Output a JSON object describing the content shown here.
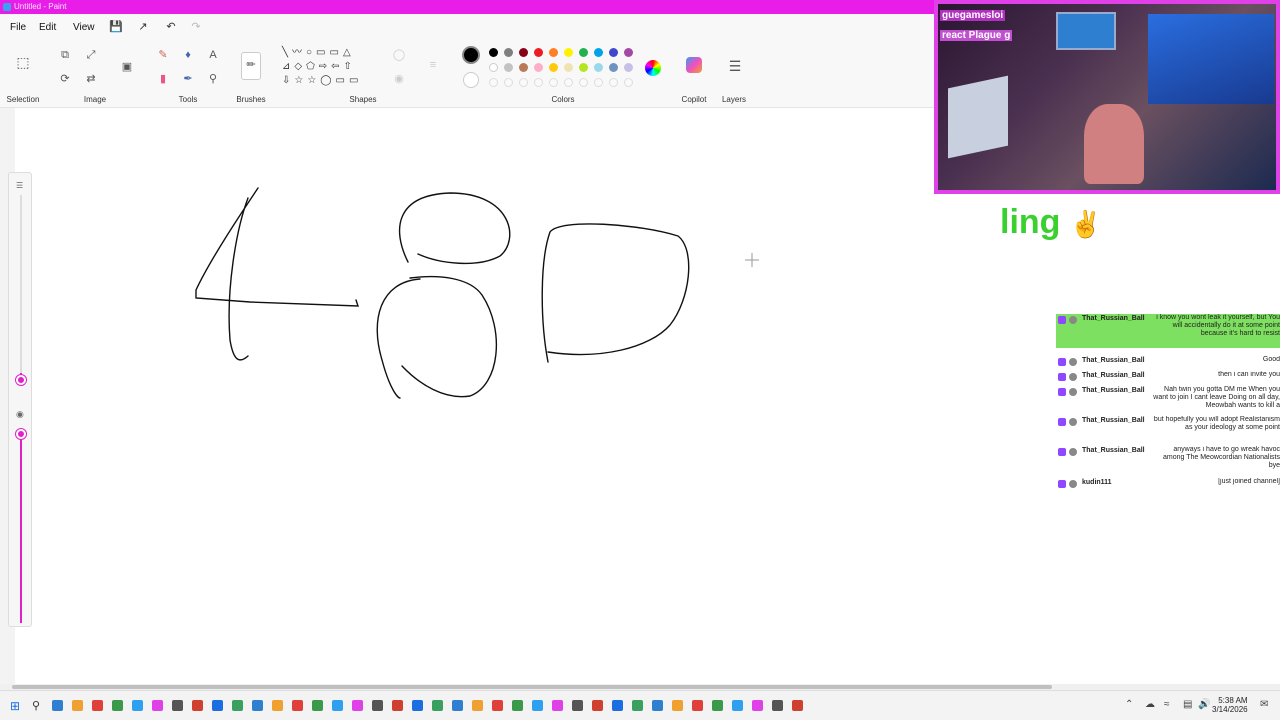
{
  "window": {
    "title": "Untitled - Paint"
  },
  "menu": {
    "file": "File",
    "edit": "Edit",
    "view": "View"
  },
  "ribbon": {
    "groups": {
      "selection": "Selection",
      "image": "Image",
      "tools": "Tools",
      "brushes": "Brushes",
      "shapes": "Shapes",
      "colors": "Colors",
      "copilot": "Copilot",
      "layers": "Layers"
    },
    "palette_row1": [
      "#000000",
      "#7f7f7f",
      "#880015",
      "#ed1c24",
      "#ff7f27",
      "#fff200",
      "#22b14c",
      "#00a2e8",
      "#3f48cc",
      "#a349a4"
    ],
    "palette_row2": [
      "#ffffff",
      "#c3c3c3",
      "#b97a57",
      "#ffaec9",
      "#ffc90e",
      "#efe4b0",
      "#b5e61d",
      "#99d9ea",
      "#7092be",
      "#c8bfe7"
    ],
    "primary_color": "#000000",
    "secondary_color": "#ffffff"
  },
  "stream": {
    "overlay_text": "ling",
    "camera_title": "guegamesloi",
    "camera_subtitle": "react Plague g",
    "chat": [
      {
        "user": "That_Russian_Ball",
        "message": "i know you wont leak it yourself, but You will accidentally do it at some point because it's hard to resist"
      },
      {
        "user": "That_Russian_Ball",
        "message": "Good"
      },
      {
        "user": "That_Russian_Ball",
        "message": "then i can invite you"
      },
      {
        "user": "That_Russian_Ball",
        "message": "Nah twin you gotta DM me When you want to join I cant leave Doing on all day, Meowbah wants to kill a"
      },
      {
        "user": "That_Russian_Ball",
        "message": "but hopefully you will adopt Realistanism as your ideology at some point"
      },
      {
        "user": "That_Russian_Ball",
        "message": "anyways i have to go wreak havoc among The Meowcordian Nationalists bye"
      },
      {
        "user": "kudin111",
        "message": "[just joined channel]"
      }
    ]
  },
  "taskbar": {
    "time": "5:38 AM",
    "date": "3/14/2026"
  },
  "colors": {
    "accent": "#e020c8",
    "stream_frame": "#e040e8",
    "overlay_green": "#39d030",
    "chat_highlight": "#7ee060"
  }
}
